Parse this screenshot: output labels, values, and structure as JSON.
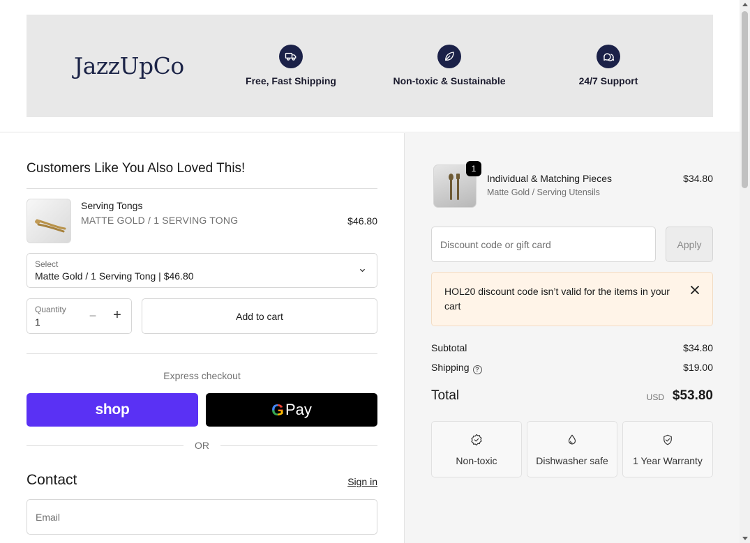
{
  "header": {
    "logo": "JazzUpCo",
    "features": [
      {
        "icon": "truck-icon",
        "label": "Free, Fast Shipping"
      },
      {
        "icon": "leaf-icon",
        "label": "Non-toxic & Sustainable"
      },
      {
        "icon": "chat-icon",
        "label": "24/7 Support"
      }
    ]
  },
  "upsell": {
    "title": "Customers Like You Also Loved This!",
    "product": {
      "name": "Serving Tongs",
      "variant": "MATTE GOLD / 1 SERVING TONG",
      "price": "$46.80"
    },
    "select": {
      "label": "Select",
      "value": "Matte Gold / 1 Serving Tong | $46.80"
    },
    "quantity": {
      "label": "Quantity",
      "value": "1"
    },
    "add_to_cart": "Add to cart"
  },
  "express": {
    "label": "Express checkout",
    "shop_label": "shop",
    "gpay_label": "Pay",
    "gpay_g": "G",
    "or": "OR"
  },
  "contact": {
    "title": "Contact",
    "sign_in": "Sign in",
    "email_placeholder": "Email"
  },
  "order": {
    "item": {
      "name": "Individual & Matching Pieces",
      "variant": "Matte Gold / Serving Utensils",
      "price": "$34.80",
      "quantity": "1"
    },
    "discount_placeholder": "Discount code or gift card",
    "apply": "Apply",
    "alert": "HOL20 discount code isn’t valid for the items in your cart",
    "subtotal_label": "Subtotal",
    "subtotal": "$34.80",
    "shipping_label": "Shipping",
    "shipping": "$19.00",
    "total_label": "Total",
    "currency": "USD",
    "total": "$53.80",
    "badges": [
      {
        "icon": "badge-check-icon",
        "label": "Non-toxic"
      },
      {
        "icon": "drop-icon",
        "label": "Dishwasher safe"
      },
      {
        "icon": "shield-check-icon",
        "label": "1 Year Warranty"
      }
    ]
  },
  "colors": {
    "brand_navy": "#1b2148",
    "shop_purple": "#5a31f4",
    "alert_bg": "#fff4e8"
  }
}
